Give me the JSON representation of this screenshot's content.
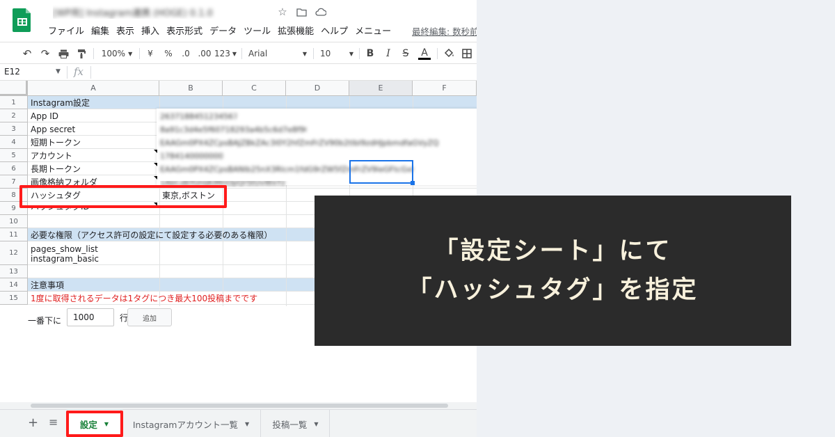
{
  "app": {
    "doc_title_blurred": "[WP用] Instagram連携 (HOGE) 0.1.0",
    "menu": [
      "ファイル",
      "編集",
      "表示",
      "挿入",
      "表示形式",
      "データ",
      "ツール",
      "拡張機能",
      "ヘルプ",
      "メニュー"
    ],
    "last_edit": "最終編集: 数秒前"
  },
  "toolbar": {
    "zoom": "100%",
    "currency": "¥",
    "percent": "%",
    "dec_less": ".0",
    "dec_more": ".00",
    "number_format": "123",
    "font": "Arial",
    "font_size": "10",
    "bold": "B",
    "italic": "I",
    "strike": "S",
    "text_color": "A"
  },
  "formula_bar": {
    "cell_ref": "E12",
    "fx": "fx"
  },
  "grid": {
    "columns": [
      "A",
      "B",
      "C",
      "D",
      "E",
      "F"
    ],
    "rows": [
      "1",
      "2",
      "3",
      "4",
      "5",
      "6",
      "7",
      "8",
      "9",
      "10",
      "11",
      "12",
      "13",
      "14",
      "15"
    ],
    "cells": {
      "r1": "Instagram設定",
      "r2": "App ID",
      "r3": "App secret",
      "r4": "短期トークン",
      "r5": "アカウント",
      "r6": "長期トークン",
      "r7": "画像格納フォルダ",
      "r8": "ハッシュタグ",
      "r8b": "東京,ボストン",
      "r9": "ハッシュタグID",
      "r11": "必要な権限（アクセス許可の設定にて設定する必要のある権限）",
      "r12a": "pages_show_list",
      "r12b": "instagram_basic",
      "r14": "注意事項",
      "r15": "1度に取得されるデータは1タグにつき最大100投稿までです"
    },
    "blurred_values": {
      "r2": "2637188451234567",
      "r3": "8a91c3d4e5f60718293a4b5c6d7e8f90",
      "r4": "EAAGm0PX4ZCpsBAJZBkZAc3l0Y2hfZmFrZV90b2tlbl9zdHJpbmdfaGVyZQ",
      "r5": "17841400000000",
      "r6": "EAAGm0PX4ZCpsBANlb25nX3Rlcm1fdG9rZW5fZmFrZV9leGFtcGxl",
      "r7": "1AbCdEfGhIjKlMnOpQrStUvWxYz"
    }
  },
  "add_rows": {
    "label": "一番下に",
    "count": "1000",
    "unit": "行",
    "button": "追加"
  },
  "tabs": [
    {
      "label": "設定"
    },
    {
      "label": "Instagramアカウント一覧"
    },
    {
      "label": "投稿一覧"
    }
  ],
  "callout": {
    "line1": "「設定シート」にて",
    "line2": "「ハッシュタグ」を指定"
  },
  "colors": {
    "highlight_red": "#ff1a1a",
    "header_blue": "#cfe2f3",
    "callout_bg": "#2b2b2b",
    "callout_text": "#f8f1dc",
    "sheets_green": "#188038"
  }
}
